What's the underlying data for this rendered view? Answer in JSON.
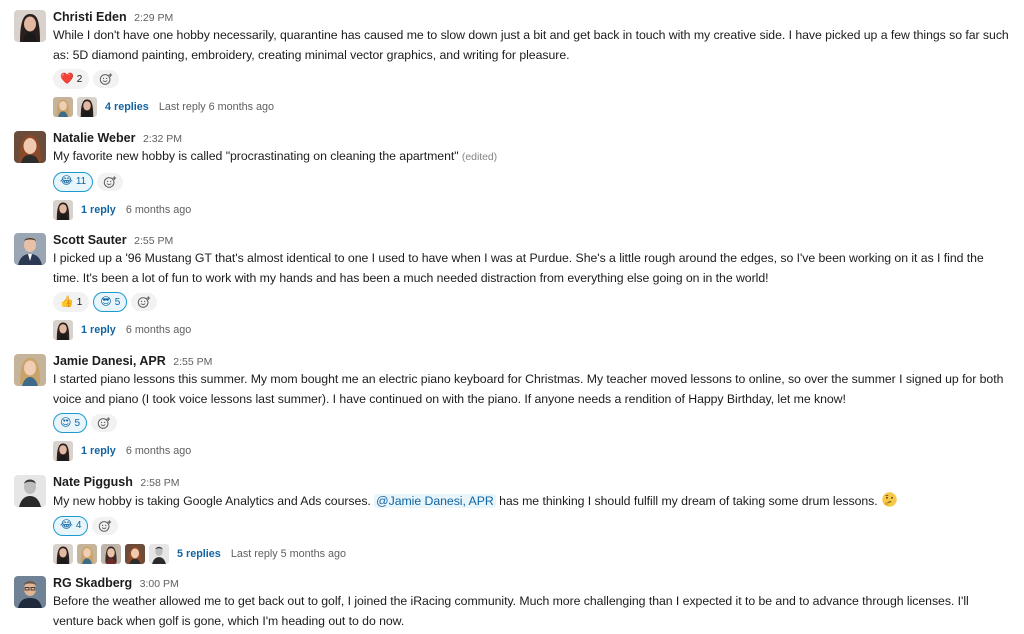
{
  "messages": [
    {
      "name": "Christi Eden",
      "time": "2:29 PM",
      "text": "While I don't have one hobby necessarily, quarantine has caused me to slow down just a bit and get back in touch with my creative side. I have picked up a few things so far such as: 5D diamond painting, embroidery, creating minimal vector graphics, and writing for pleasure.",
      "reactions": [
        {
          "emoji": "❤️",
          "count": "2"
        }
      ],
      "thread": {
        "replies": "4 replies",
        "last": "Last reply 6 months ago"
      }
    },
    {
      "name": "Natalie Weber",
      "time": "2:32 PM",
      "text": "My favorite new hobby is called \"procrastinating on cleaning the apartment\"",
      "edited": "(edited)",
      "reactions": [
        {
          "emoji": "😂",
          "count": "11"
        }
      ],
      "thread": {
        "replies": "1 reply",
        "last": "6 months ago"
      }
    },
    {
      "name": "Scott Sauter",
      "time": "2:55 PM",
      "text": "I picked up a '96 Mustang GT that's almost identical to one I used to have when I was at Purdue.  She's a little rough around the edges, so I've been working on it as I find the time.  It's been a lot of fun to work with my hands and has been a much needed distraction from everything else going on in the world!",
      "reactions": [
        {
          "emoji": "👍",
          "count": "1"
        },
        {
          "emoji": "😎",
          "count": "5"
        }
      ],
      "thread": {
        "replies": "1 reply",
        "last": "6 months ago"
      }
    },
    {
      "name": "Jamie Danesi, APR",
      "time": "2:55 PM",
      "text": "I started piano lessons this summer.  My mom bought me an electric piano keyboard for Christmas.  My teacher moved lessons to online, so over the summer I signed up for both voice and piano (I took voice lessons last summer).  I have continued on with the piano.  If anyone needs a rendition of Happy Birthday, let me know!",
      "reactions": [
        {
          "emoji": "😍",
          "count": "5"
        }
      ],
      "thread": {
        "replies": "1 reply",
        "last": "6 months ago"
      }
    },
    {
      "name": "Nate Piggush",
      "time": "2:58 PM",
      "text_before": "My new hobby is taking Google Analytics and Ads courses.",
      "mention": "@Jamie Danesi, APR",
      "text_after": "has me thinking I should fulfill my dream of taking some drum lessons.",
      "reactions": [
        {
          "emoji": "😂",
          "count": "4"
        }
      ],
      "thread": {
        "replies": "5 replies",
        "last": "Last reply 5 months ago"
      }
    },
    {
      "name": "RG Skadberg",
      "time": "3:00 PM",
      "text": "Before the weather allowed me to get back out to golf, I joined the iRacing community. Much more challenging than I expected it to be and to advance through licenses. I'll venture back when golf is gone, which I'm heading out to do now."
    }
  ],
  "colors": {
    "link": "#1264a3",
    "mine_border": "#1d9bd1",
    "mine_bg": "#e8f5fa"
  }
}
